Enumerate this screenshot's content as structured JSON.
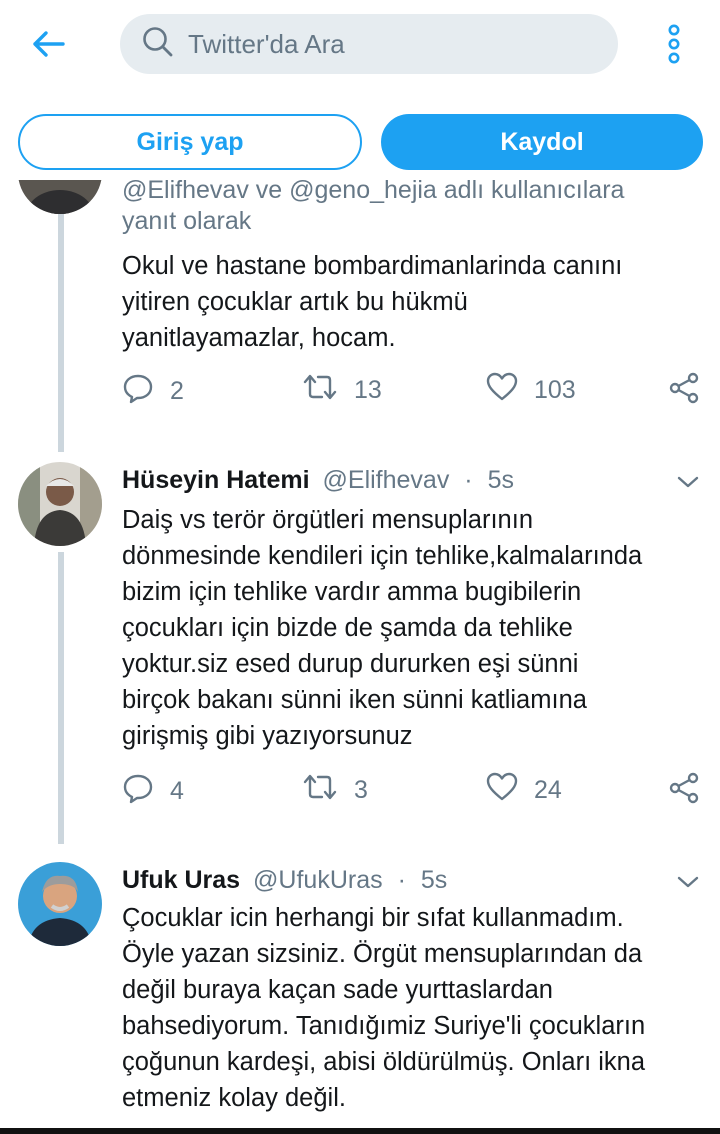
{
  "header": {
    "search_placeholder": "Twitter'da Ara",
    "login_label": "Giriş yap",
    "signup_label": "Kaydol",
    "accent_color": "#1da1f2"
  },
  "tweets": [
    {
      "partial_reply_line": "@Elifhevav ve @geno_hejia adlı kullanıcılara",
      "reply_to_text": "yanıt olarak",
      "text_lines": [
        "Okul ve hastane bombardimanlarinda canını",
        "yitiren çocuklar artık bu hükmü",
        "yanitlayamazlar, hocam."
      ],
      "replies": "2",
      "retweets": "13",
      "likes": "103"
    },
    {
      "name": "Hüseyin Hatemi",
      "handle": "@Elifhevav",
      "dot": "·",
      "time": "5s",
      "text_lines": [
        "Daiş vs terör örgütleri mensuplarının",
        "dönmesinde kendileri için tehlike,kalmalarında",
        "bizim için tehlike vardır amma bugibilerin",
        "çocukları için bizde de şamda da tehlike",
        "yoktur.siz esed durup dururken eşi sünni",
        "birçok bakanı sünni iken sünni katliamına",
        "girişmiş gibi yazıyorsunuz"
      ],
      "replies": "4",
      "retweets": "3",
      "likes": "24"
    },
    {
      "name": "Ufuk Uras",
      "handle": "@UfukUras",
      "dot": "·",
      "time": "5s",
      "text_lines": [
        "Çocuklar icin herhangi bir sıfat kullanmadım.",
        "Öyle yazan sizsiniz. Örgüt mensuplarından da",
        "değil buraya kaçan sade yurttaslardan",
        "bahsediyorum. Tanıdığımiz Suriye'li çocukların",
        "çoğunun kardeşi, abisi öldürülmüş. Onları ikna",
        "etmeniz kolay değil."
      ]
    }
  ]
}
